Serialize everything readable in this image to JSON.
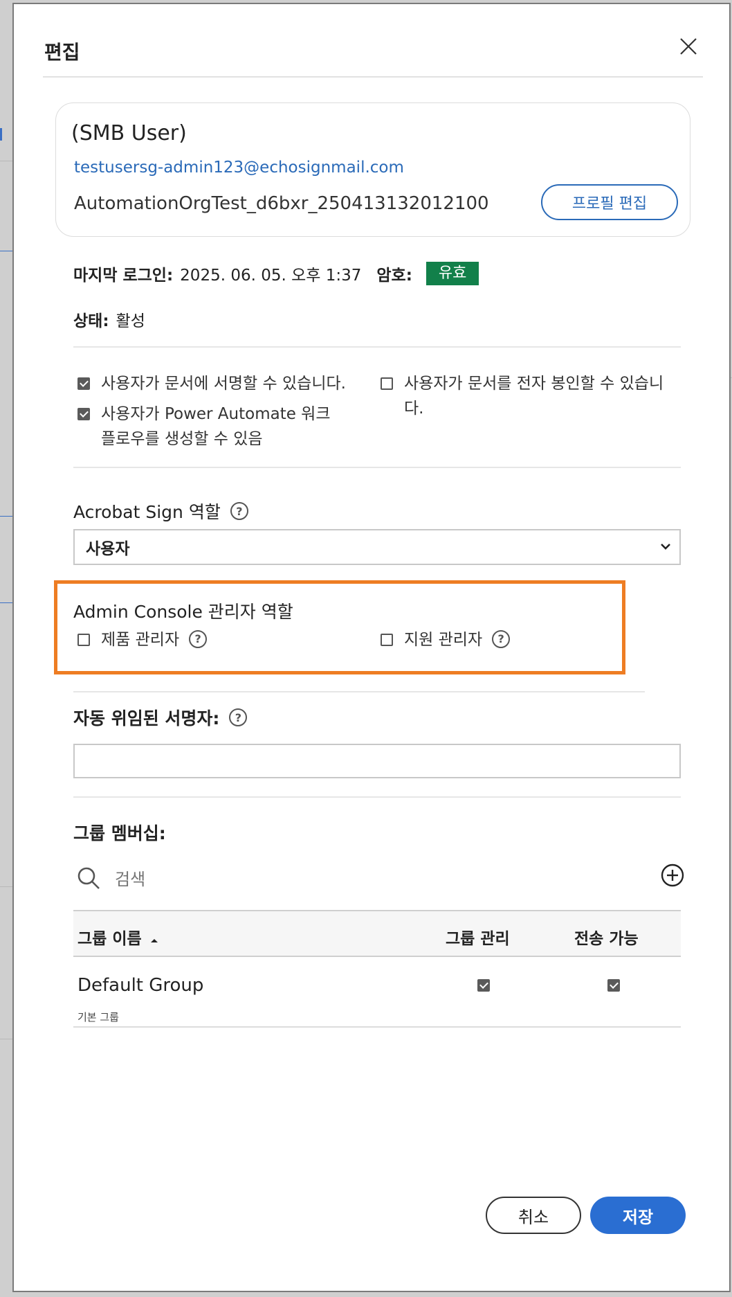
{
  "dialog": {
    "title": "편집",
    "close_icon": "close-icon"
  },
  "profile": {
    "name": "(SMB User)",
    "email": "testusersg-admin123@echosignmail.com",
    "org": "AutomationOrgTest_d6bxr_250413132012100",
    "edit_button": "프로필 편집"
  },
  "info": {
    "last_login_label": "마지막 로그인:",
    "last_login_value": "2025. 06. 05. 오후 1:37",
    "password_label": "암호:",
    "password_badge": "유효",
    "password_badge_color": "#12804a",
    "status_label": "상태:",
    "status_value": "활성"
  },
  "permissions": {
    "can_sign": "사용자가 문서에 서명할 수 있습니다.",
    "can_sign_checked": true,
    "can_seal": "사용자가 문서를 전자 봉인할 수 있습니다.",
    "can_seal_checked": false,
    "power_automate": "사용자가 Power Automate 워크플로우를 생성할 수 있음",
    "power_automate_checked": true
  },
  "role": {
    "label": "Acrobat Sign 역할",
    "selected": "사용자"
  },
  "admin_console": {
    "label": "Admin Console 관리자 역할",
    "product_admin": "제품 관리자",
    "support_admin": "지원 관리자",
    "highlight_color": "#ee7d23"
  },
  "auto_delegate": {
    "label": "자동 위임된 서명자:",
    "value": ""
  },
  "groups": {
    "label": "그룹 멤버십:",
    "search_placeholder": "검색",
    "columns": {
      "name": "그룹 이름",
      "manage": "그룹 관리",
      "send": "전송 가능"
    },
    "rows": [
      {
        "name": "Default Group",
        "subtitle": "기본 그룹",
        "manage": true,
        "send": true
      }
    ]
  },
  "footer": {
    "cancel": "취소",
    "save": "저장",
    "save_color": "#2a6ed2"
  }
}
